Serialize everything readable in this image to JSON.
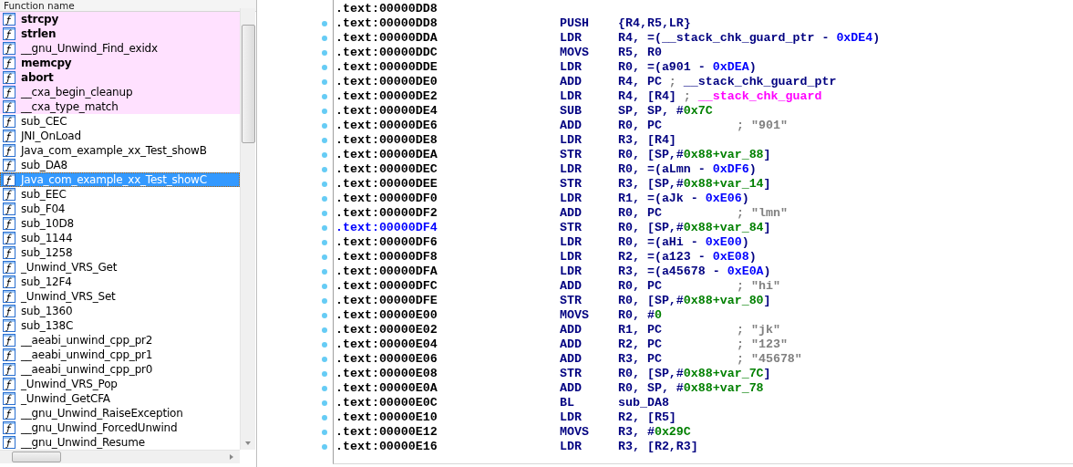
{
  "functions_panel": {
    "header": "Function name",
    "functions": [
      {
        "name": "strcpy",
        "bold": true,
        "library": true,
        "selected": false
      },
      {
        "name": "strlen",
        "bold": true,
        "library": true,
        "selected": false
      },
      {
        "name": "__gnu_Unwind_Find_exidx",
        "bold": false,
        "library": true,
        "selected": false
      },
      {
        "name": "memcpy",
        "bold": true,
        "library": true,
        "selected": false
      },
      {
        "name": "abort",
        "bold": true,
        "library": true,
        "selected": false
      },
      {
        "name": "__cxa_begin_cleanup",
        "bold": false,
        "library": true,
        "selected": false
      },
      {
        "name": "__cxa_type_match",
        "bold": false,
        "library": true,
        "selected": false
      },
      {
        "name": "sub_CEC",
        "bold": false,
        "library": false,
        "selected": false
      },
      {
        "name": "JNI_OnLoad",
        "bold": false,
        "library": false,
        "selected": false
      },
      {
        "name": "Java_com_example_xx_Test_showB",
        "bold": false,
        "library": false,
        "selected": false
      },
      {
        "name": "sub_DA8",
        "bold": false,
        "library": false,
        "selected": false
      },
      {
        "name": "Java_com_example_xx_Test_showC",
        "bold": false,
        "library": false,
        "selected": true
      },
      {
        "name": "sub_EEC",
        "bold": false,
        "library": false,
        "selected": false
      },
      {
        "name": "sub_F04",
        "bold": false,
        "library": false,
        "selected": false
      },
      {
        "name": "sub_10D8",
        "bold": false,
        "library": false,
        "selected": false
      },
      {
        "name": "sub_1144",
        "bold": false,
        "library": false,
        "selected": false
      },
      {
        "name": "sub_1258",
        "bold": false,
        "library": false,
        "selected": false
      },
      {
        "name": "_Unwind_VRS_Get",
        "bold": false,
        "library": false,
        "selected": false
      },
      {
        "name": "sub_12F4",
        "bold": false,
        "library": false,
        "selected": false
      },
      {
        "name": "_Unwind_VRS_Set",
        "bold": false,
        "library": false,
        "selected": false
      },
      {
        "name": "sub_1360",
        "bold": false,
        "library": false,
        "selected": false
      },
      {
        "name": "sub_138C",
        "bold": false,
        "library": false,
        "selected": false
      },
      {
        "name": "__aeabi_unwind_cpp_pr2",
        "bold": false,
        "library": false,
        "selected": false
      },
      {
        "name": "__aeabi_unwind_cpp_pr1",
        "bold": false,
        "library": false,
        "selected": false
      },
      {
        "name": "__aeabi_unwind_cpp_pr0",
        "bold": false,
        "library": false,
        "selected": false
      },
      {
        "name": "_Unwind_VRS_Pop",
        "bold": false,
        "library": false,
        "selected": false
      },
      {
        "name": "_Unwind_GetCFA",
        "bold": false,
        "library": false,
        "selected": false
      },
      {
        "name": "__gnu_Unwind_RaiseException",
        "bold": false,
        "library": false,
        "selected": false
      },
      {
        "name": "__gnu_Unwind_ForcedUnwind",
        "bold": false,
        "library": false,
        "selected": false
      },
      {
        "name": "__gnu_Unwind_Resume",
        "bold": false,
        "library": false,
        "selected": false
      }
    ]
  },
  "disassembly": {
    "lines": [
      {
        "address": ".text:00000DD8",
        "selected": false
      },
      {
        "address": ".text:00000DD8",
        "mnemonic": "PUSH",
        "operand": [
          {
            "kind": "text",
            "text": "{R4,R5,LR}"
          }
        ],
        "selected": false
      },
      {
        "address": ".text:00000DDA",
        "mnemonic": "LDR",
        "operand": [
          {
            "kind": "text",
            "text": "R4, =(__stack_chk_guard_ptr - "
          },
          {
            "kind": "offset",
            "text": "0xDE4"
          },
          {
            "kind": "text",
            "text": ")"
          }
        ],
        "selected": false
      },
      {
        "address": ".text:00000DDC",
        "mnemonic": "MOVS",
        "operand": [
          {
            "kind": "text",
            "text": "R5, R0"
          }
        ],
        "selected": false
      },
      {
        "address": ".text:00000DDE",
        "mnemonic": "LDR",
        "operand": [
          {
            "kind": "text",
            "text": "R0, =(a901 - "
          },
          {
            "kind": "offset",
            "text": "0xDEA"
          },
          {
            "kind": "text",
            "text": ")"
          }
        ],
        "selected": false
      },
      {
        "address": ".text:00000DE0",
        "mnemonic": "ADD",
        "operand": [
          {
            "kind": "text",
            "text": "R4, PC "
          },
          {
            "kind": "comment",
            "text": "; "
          },
          {
            "kind": "text",
            "text": "__stack_chk_guard_ptr"
          }
        ],
        "selected": false
      },
      {
        "address": ".text:00000DE2",
        "mnemonic": "LDR",
        "operand": [
          {
            "kind": "text",
            "text": "R4, [R4] "
          },
          {
            "kind": "comment",
            "text": "; "
          },
          {
            "kind": "import",
            "text": "__stack_chk_guard"
          }
        ],
        "selected": false
      },
      {
        "address": ".text:00000DE4",
        "mnemonic": "SUB",
        "operand": [
          {
            "kind": "text",
            "text": "SP, SP, #"
          },
          {
            "kind": "immediate",
            "text": "0x7C"
          }
        ],
        "selected": false
      },
      {
        "address": ".text:00000DE6",
        "mnemonic": "ADD",
        "operand": [
          {
            "kind": "text",
            "text": "R0, PC"
          }
        ],
        "comment": "; \"901\"",
        "selected": false
      },
      {
        "address": ".text:00000DE8",
        "mnemonic": "LDR",
        "operand": [
          {
            "kind": "text",
            "text": "R3, [R4]"
          }
        ],
        "selected": false
      },
      {
        "address": ".text:00000DEA",
        "mnemonic": "STR",
        "operand": [
          {
            "kind": "text",
            "text": "R0, [SP,#"
          },
          {
            "kind": "immediate",
            "text": "0x88+var_88"
          },
          {
            "kind": "text",
            "text": "]"
          }
        ],
        "selected": false
      },
      {
        "address": ".text:00000DEC",
        "mnemonic": "LDR",
        "operand": [
          {
            "kind": "text",
            "text": "R0, =(aLmn - "
          },
          {
            "kind": "offset",
            "text": "0xDF6"
          },
          {
            "kind": "text",
            "text": ")"
          }
        ],
        "selected": false
      },
      {
        "address": ".text:00000DEE",
        "mnemonic": "STR",
        "operand": [
          {
            "kind": "text",
            "text": "R3, [SP,#"
          },
          {
            "kind": "immediate",
            "text": "0x88+var_14"
          },
          {
            "kind": "text",
            "text": "]"
          }
        ],
        "selected": false
      },
      {
        "address": ".text:00000DF0",
        "mnemonic": "LDR",
        "operand": [
          {
            "kind": "text",
            "text": "R1, =(aJk - "
          },
          {
            "kind": "offset",
            "text": "0xE06"
          },
          {
            "kind": "text",
            "text": ")"
          }
        ],
        "selected": false
      },
      {
        "address": ".text:00000DF2",
        "mnemonic": "ADD",
        "operand": [
          {
            "kind": "text",
            "text": "R0, PC"
          }
        ],
        "comment": "; \"lmn\"",
        "selected": false
      },
      {
        "address": ".text:00000DF4",
        "mnemonic": "STR",
        "operand": [
          {
            "kind": "text",
            "text": "R0, [SP,#"
          },
          {
            "kind": "immediate",
            "text": "0x88+var_84"
          },
          {
            "kind": "text",
            "text": "]"
          }
        ],
        "selected": true
      },
      {
        "address": ".text:00000DF6",
        "mnemonic": "LDR",
        "operand": [
          {
            "kind": "text",
            "text": "R0, =(aHi - "
          },
          {
            "kind": "offset",
            "text": "0xE00"
          },
          {
            "kind": "text",
            "text": ")"
          }
        ],
        "selected": false
      },
      {
        "address": ".text:00000DF8",
        "mnemonic": "LDR",
        "operand": [
          {
            "kind": "text",
            "text": "R2, =(a123 - "
          },
          {
            "kind": "offset",
            "text": "0xE08"
          },
          {
            "kind": "text",
            "text": ")"
          }
        ],
        "selected": false
      },
      {
        "address": ".text:00000DFA",
        "mnemonic": "LDR",
        "operand": [
          {
            "kind": "text",
            "text": "R3, =(a45678 - "
          },
          {
            "kind": "offset",
            "text": "0xE0A"
          },
          {
            "kind": "text",
            "text": ")"
          }
        ],
        "selected": false
      },
      {
        "address": ".text:00000DFC",
        "mnemonic": "ADD",
        "operand": [
          {
            "kind": "text",
            "text": "R0, PC"
          }
        ],
        "comment": "; \"hi\"",
        "selected": false
      },
      {
        "address": ".text:00000DFE",
        "mnemonic": "STR",
        "operand": [
          {
            "kind": "text",
            "text": "R0, [SP,#"
          },
          {
            "kind": "immediate",
            "text": "0x88+var_80"
          },
          {
            "kind": "text",
            "text": "]"
          }
        ],
        "selected": false
      },
      {
        "address": ".text:00000E00",
        "mnemonic": "MOVS",
        "operand": [
          {
            "kind": "text",
            "text": "R0, #"
          },
          {
            "kind": "immediate",
            "text": "0"
          }
        ],
        "selected": false
      },
      {
        "address": ".text:00000E02",
        "mnemonic": "ADD",
        "operand": [
          {
            "kind": "text",
            "text": "R1, PC"
          }
        ],
        "comment": "; \"jk\"",
        "selected": false
      },
      {
        "address": ".text:00000E04",
        "mnemonic": "ADD",
        "operand": [
          {
            "kind": "text",
            "text": "R2, PC"
          }
        ],
        "comment": "; \"123\"",
        "selected": false
      },
      {
        "address": ".text:00000E06",
        "mnemonic": "ADD",
        "operand": [
          {
            "kind": "text",
            "text": "R3, PC"
          }
        ],
        "comment": "; \"45678\"",
        "selected": false
      },
      {
        "address": ".text:00000E08",
        "mnemonic": "STR",
        "operand": [
          {
            "kind": "text",
            "text": "R0, [SP,#"
          },
          {
            "kind": "immediate",
            "text": "0x88+var_7C"
          },
          {
            "kind": "text",
            "text": "]"
          }
        ],
        "selected": false
      },
      {
        "address": ".text:00000E0A",
        "mnemonic": "ADD",
        "operand": [
          {
            "kind": "text",
            "text": "R0, SP, #"
          },
          {
            "kind": "immediate",
            "text": "0x88+var_78"
          }
        ],
        "selected": false
      },
      {
        "address": ".text:00000E0C",
        "mnemonic": "BL",
        "operand": [
          {
            "kind": "text",
            "text": "sub_DA8"
          }
        ],
        "selected": false
      },
      {
        "address": ".text:00000E10",
        "mnemonic": "LDR",
        "operand": [
          {
            "kind": "text",
            "text": "R2, [R5]"
          }
        ],
        "selected": false
      },
      {
        "address": ".text:00000E12",
        "mnemonic": "MOVS",
        "operand": [
          {
            "kind": "text",
            "text": "R3, #"
          },
          {
            "kind": "immediate",
            "text": "0x29C"
          }
        ],
        "selected": false
      },
      {
        "address": ".text:00000E16",
        "mnemonic": "LDR",
        "operand": [
          {
            "kind": "text",
            "text": "R3, [R2,R3]"
          }
        ],
        "selected": false
      }
    ]
  }
}
